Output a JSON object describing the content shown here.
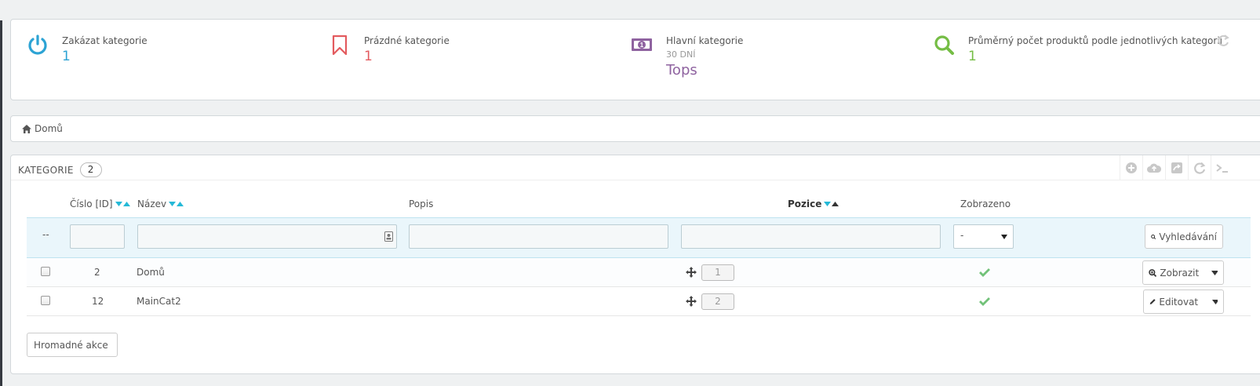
{
  "kpis": [
    {
      "title": "Zakázat kategorie",
      "value": "1",
      "color": "#2ca3d4",
      "icon": "power-icon"
    },
    {
      "title": "Prázdné kategorie",
      "value": "1",
      "color": "#e35b5f",
      "icon": "bookmark-icon"
    },
    {
      "title": "Hlavní kategorie",
      "subtitle": "30 DNÍ",
      "value": "Tops",
      "color": "#8f63a0",
      "icon": "money-icon"
    },
    {
      "title": "Průměrný počet produktů podle jednotlivých kategorií",
      "value": "1",
      "color": "#75bd45",
      "icon": "search-icon"
    }
  ],
  "breadcrumb": {
    "home_icon": "home-icon",
    "label": "Domů"
  },
  "list": {
    "title": "KATEGORIE",
    "count": "2",
    "toolbar": [
      "add-icon",
      "cloud-upload-icon",
      "export-icon",
      "refresh-icon",
      "terminal-icon"
    ],
    "columns": {
      "id": "Číslo [ID]",
      "name": "Název",
      "description": "Popis",
      "position": "Pozice",
      "displayed": "Zobrazeno"
    },
    "filters": {
      "dash": "--",
      "displayed_select": "-",
      "search_button": "Vyhledávání"
    },
    "rows": [
      {
        "id": "2",
        "name": "Domů",
        "position": "1",
        "displayed": true,
        "action": "Zobrazit",
        "action_icon": "zoom-icon"
      },
      {
        "id": "12",
        "name": "MainCat2",
        "position": "2",
        "displayed": true,
        "action": "Editovat",
        "action_icon": "pencil-icon"
      }
    ],
    "bulk_button": "Hromadné akce"
  },
  "colors": {
    "sort_active": "#25b9d7",
    "check": "#72c279",
    "background": "#eff1f2"
  }
}
